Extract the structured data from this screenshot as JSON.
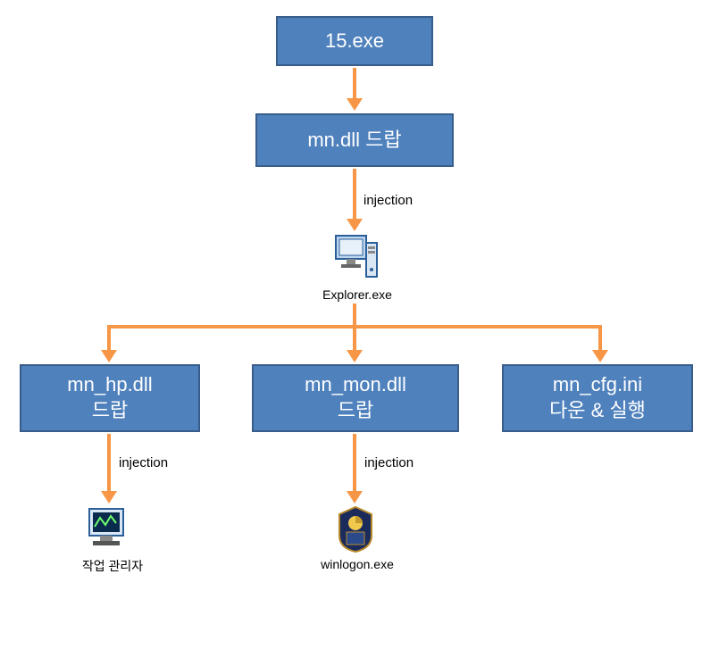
{
  "nodes": {
    "root": "15.exe",
    "mn_dll": "mn.dll 드랍",
    "mn_hp_dll": "mn_hp.dll\n드랍",
    "mn_mon_dll": "mn_mon.dll\n드랍",
    "mn_cfg_ini": "mn_cfg.ini\n다운 & 실행"
  },
  "icons": {
    "explorer": "Explorer.exe",
    "taskmgr": "작업 관리자",
    "winlogon": "winlogon.exe"
  },
  "edges": {
    "injection1": "injection",
    "injection2": "injection",
    "injection3": "injection"
  },
  "colors": {
    "node_fill": "#4f81bd",
    "node_border": "#385d8a",
    "arrow": "#f79646"
  }
}
